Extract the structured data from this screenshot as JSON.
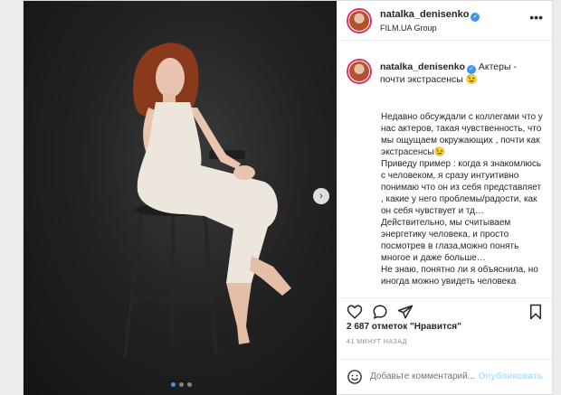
{
  "post": {
    "account": {
      "username": "natalka_denisenko",
      "subtitle": "FILM.UA Group",
      "verified_mark": "✓"
    },
    "caption": {
      "username": "natalka_denisenko",
      "title": "Актеры - почти экстрасенсы 😉",
      "body": "Недавно обсуждали с коллегами что у нас актеров, такая чувственность, что мы ощущаем окружающих , почти как экстрасенсы😉\nПриведу пример : когда я знакомлюсь с человеком, я сразу интуитивно понимаю что он из себя представляет , какие у него проблемы/радости, как он себя чувствует и тд…\nДействительно, мы считываем энергетику человека, и просто посмотрев в глаза,можно понять многое и даже больше…\nНе знаю, понятно ли я объяснила, но иногда можно увидеть человека"
    },
    "more_icon": "•••",
    "likes": "2 687 отметок \"Нравится\"",
    "time": "41 МИНУТ НАЗАД",
    "comment_placeholder": "Добавьте комментарий...",
    "publish_label": "Опубликовать",
    "next_glyph": "›",
    "icons": [
      "heart-icon",
      "comment-icon",
      "share-icon",
      "bookmark-icon",
      "emoji-icon",
      "chevron-right-icon"
    ],
    "carousel": {
      "slides": 3,
      "active": 1
    },
    "colors": {
      "accent": "#3897f0",
      "story_ring": "#e1306c",
      "publish_disabled": "#b2dffc"
    }
  }
}
